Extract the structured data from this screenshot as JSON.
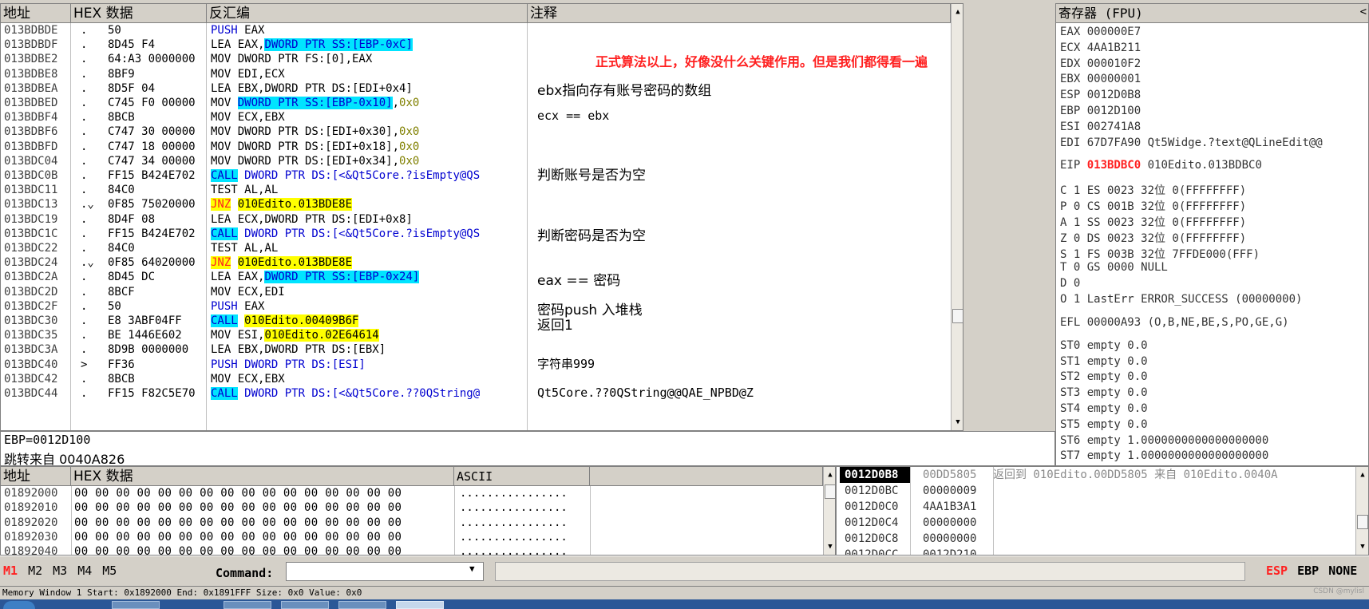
{
  "disasm": {
    "headers": {
      "addr": "地址",
      "hex": "HEX 数据",
      "asm": "反汇编",
      "comment": "注释"
    },
    "rows": [
      {
        "addr": "013BDBDE",
        "m": ".",
        "hex": "50",
        "asm": [
          {
            "t": "PUSH",
            "c": "kw-blue"
          },
          {
            "t": " EAX"
          }
        ]
      },
      {
        "addr": "013BDBDF",
        "m": ".",
        "hex": "8D45 F4",
        "asm": [
          {
            "t": "LEA EAX,"
          },
          {
            "t": "DWORD PTR SS:[EBP-0xC]",
            "c": "hl-c kw-blue"
          }
        ]
      },
      {
        "addr": "013BDBE2",
        "m": ".",
        "hex": "64:A3 0000000",
        "asm": [
          {
            "t": "MOV DWORD PTR FS:[0],EAX"
          }
        ]
      },
      {
        "addr": "013BDBE8",
        "m": ".",
        "hex": "8BF9",
        "asm": [
          {
            "t": "MOV EDI,ECX"
          }
        ]
      },
      {
        "addr": "013BDBEA",
        "m": ".",
        "hex": "8D5F 04",
        "asm": [
          {
            "t": "LEA EBX,DWORD PTR DS:[EDI+0x4]"
          }
        ]
      },
      {
        "addr": "013BDBED",
        "m": ".",
        "hex": "C745 F0 00000",
        "asm": [
          {
            "t": "MOV "
          },
          {
            "t": "DWORD PTR SS:[EBP-0x10]",
            "c": "hl-c kw-blue"
          },
          {
            "t": ","
          },
          {
            "t": "0x0",
            "c": "num-o"
          }
        ]
      },
      {
        "addr": "013BDBF4",
        "m": ".",
        "hex": "8BCB",
        "asm": [
          {
            "t": "MOV ECX,EBX"
          }
        ]
      },
      {
        "addr": "013BDBF6",
        "m": ".",
        "hex": "C747 30 00000",
        "asm": [
          {
            "t": "MOV DWORD PTR DS:[EDI+0x30],"
          },
          {
            "t": "0x0",
            "c": "num-o"
          }
        ]
      },
      {
        "addr": "013BDBFD",
        "m": ".",
        "hex": "C747 18 00000",
        "asm": [
          {
            "t": "MOV DWORD PTR DS:[EDI+0x18],"
          },
          {
            "t": "0x0",
            "c": "num-o"
          }
        ]
      },
      {
        "addr": "013BDC04",
        "m": ".",
        "hex": "C747 34 00000",
        "asm": [
          {
            "t": "MOV DWORD PTR DS:[EDI+0x34],"
          },
          {
            "t": "0x0",
            "c": "num-o"
          }
        ]
      },
      {
        "addr": "013BDC0B",
        "m": ".",
        "hex": "FF15 B424E702",
        "asm": [
          {
            "t": "CALL",
            "c": "hl-c kw-blue"
          },
          {
            "t": " DWORD PTR DS:[<&Qt5Core.?isEmpty@QS",
            "c": "kw-blue"
          }
        ]
      },
      {
        "addr": "013BDC11",
        "m": ".",
        "hex": "84C0",
        "asm": [
          {
            "t": "TEST AL,AL"
          }
        ]
      },
      {
        "addr": "013BDC13",
        "m": ".⌄",
        "hex": "0F85 75020000",
        "asm": [
          {
            "t": "JNZ",
            "c": "hl-y kw-red"
          },
          {
            "t": " "
          },
          {
            "t": "010Edito.013BDE8E",
            "c": "hl-y"
          }
        ]
      },
      {
        "addr": "013BDC19",
        "m": ".",
        "hex": "8D4F 08",
        "asm": [
          {
            "t": "LEA ECX,DWORD PTR DS:[EDI+0x8]"
          }
        ]
      },
      {
        "addr": "013BDC1C",
        "m": ".",
        "hex": "FF15 B424E702",
        "asm": [
          {
            "t": "CALL",
            "c": "hl-c kw-blue"
          },
          {
            "t": " DWORD PTR DS:[<&Qt5Core.?isEmpty@QS",
            "c": "kw-blue"
          }
        ]
      },
      {
        "addr": "013BDC22",
        "m": ".",
        "hex": "84C0",
        "asm": [
          {
            "t": "TEST AL,AL"
          }
        ]
      },
      {
        "addr": "013BDC24",
        "m": ".⌄",
        "hex": "0F85 64020000",
        "asm": [
          {
            "t": "JNZ",
            "c": "hl-y kw-red"
          },
          {
            "t": " "
          },
          {
            "t": "010Edito.013BDE8E",
            "c": "hl-y"
          }
        ]
      },
      {
        "addr": "013BDC2A",
        "m": ".",
        "hex": "8D45 DC",
        "asm": [
          {
            "t": "LEA EAX,"
          },
          {
            "t": "DWORD PTR SS:[EBP-0x24]",
            "c": "hl-c kw-blue"
          }
        ]
      },
      {
        "addr": "013BDC2D",
        "m": ".",
        "hex": "8BCF",
        "asm": [
          {
            "t": "MOV ECX,EDI"
          }
        ]
      },
      {
        "addr": "013BDC2F",
        "m": ".",
        "hex": "50",
        "asm": [
          {
            "t": "PUSH",
            "c": "kw-blue"
          },
          {
            "t": " EAX"
          }
        ]
      },
      {
        "addr": "013BDC30",
        "m": ".",
        "hex": "E8 3ABF04FF",
        "asm": [
          {
            "t": "CALL",
            "c": "hl-c kw-blue"
          },
          {
            "t": " "
          },
          {
            "t": "010Edito.00409B6F",
            "c": "hl-y"
          }
        ]
      },
      {
        "addr": "013BDC35",
        "m": ".",
        "hex": "BE 1446E602",
        "asm": [
          {
            "t": "MOV ESI,"
          },
          {
            "t": "010Edito.02E64614",
            "c": "hl-y"
          }
        ]
      },
      {
        "addr": "013BDC3A",
        "m": ".",
        "hex": "8D9B 0000000",
        "asm": [
          {
            "t": "LEA EBX,DWORD PTR DS:[EBX]"
          }
        ]
      },
      {
        "addr": "013BDC40",
        "m": ">",
        "hex": "FF36",
        "asm": [
          {
            "t": "PUSH",
            "c": "kw-blue"
          },
          {
            "t": " DWORD PTR DS:[ESI]",
            "c": "kw-blue"
          }
        ]
      },
      {
        "addr": "013BDC42",
        "m": ".",
        "hex": "8BCB",
        "asm": [
          {
            "t": "MOV ECX,EBX"
          }
        ]
      },
      {
        "addr": "013BDC44",
        "m": ".",
        "hex": "FF15 F82C5E70",
        "asm": [
          {
            "t": "CALL",
            "c": "hl-c kw-blue"
          },
          {
            "t": " DWORD PTR DS:[<&Qt5Core.??0QString@",
            "c": "kw-blue"
          }
        ]
      }
    ],
    "comments": [
      {
        "text": "正式算法以上，好像没什么关键作用。但是我们都得看一遍",
        "red": true
      },
      {
        "text": "ebx指向存有账号密码的数组"
      },
      {
        "text": "ecx == ebx"
      },
      {
        "text": "判断账号是否为空"
      },
      {
        "text": "判断密码是否为空"
      },
      {
        "text": "eax == 密码"
      },
      {
        "text": "密码push 入堆栈"
      },
      {
        "text": "返回1"
      },
      {
        "text": "字符串999"
      },
      {
        "text": "Qt5Core.??0QString@@QAE_NPBD@Z"
      }
    ]
  },
  "info": {
    "line1": "EBP=0012D100",
    "line2": "跳转来自  0040A826"
  },
  "registers": {
    "title": "寄存器 (FPU)",
    "gpr": [
      {
        "name": "EAX",
        "val": "000000E7"
      },
      {
        "name": "ECX",
        "val": "4AA1B211"
      },
      {
        "name": "EDX",
        "val": "000010F2"
      },
      {
        "name": "EBX",
        "val": "00000001"
      },
      {
        "name": "ESP",
        "val": "0012D0B8"
      },
      {
        "name": "EBP",
        "val": "0012D100"
      },
      {
        "name": "ESI",
        "val": "002741A8"
      },
      {
        "name": "EDI",
        "val": "67D7FA90 Qt5Widge.?text@QLineEdit@@"
      }
    ],
    "eip": {
      "name": "EIP",
      "val": "013BDBC0",
      "extra": "010Edito.013BDBC0"
    },
    "flags": [
      "C 1   ES 0023 32位 0(FFFFFFFF)",
      "P 0   CS 001B 32位 0(FFFFFFFF)",
      "A 1   SS 0023 32位 0(FFFFFFFF)",
      "Z 0   DS 0023 32位 0(FFFFFFFF)",
      "S 1   FS 003B 32位 7FFDE000(FFF)",
      "T 0   GS 0000 NULL",
      "D 0",
      "O 1   LastErr ERROR_SUCCESS (00000000)"
    ],
    "efl": "EFL 00000A93 (O,B,NE,BE,S,PO,GE,G)",
    "fpu": [
      "ST0 empty 0.0",
      "ST1 empty 0.0",
      "ST2 empty 0.0",
      "ST3 empty 0.0",
      "ST4 empty 0.0",
      "ST5 empty 0.0",
      "ST6 empty 1.0000000000000000000",
      "ST7 empty 1.0000000000000000000"
    ]
  },
  "dump": {
    "headers": {
      "addr": "地址",
      "hex": "HEX 数据",
      "ascii": "ASCII"
    },
    "rows": [
      {
        "addr": "01892000",
        "hex": "00 00 00 00 00 00 00 00 00 00 00 00 00 00 00 00",
        "ascii": "................"
      },
      {
        "addr": "01892010",
        "hex": "00 00 00 00 00 00 00 00 00 00 00 00 00 00 00 00",
        "ascii": "................"
      },
      {
        "addr": "01892020",
        "hex": "00 00 00 00 00 00 00 00 00 00 00 00 00 00 00 00",
        "ascii": "................"
      },
      {
        "addr": "01892030",
        "hex": "00 00 00 00 00 00 00 00 00 00 00 00 00 00 00 00",
        "ascii": "................"
      },
      {
        "addr": "01892040",
        "hex": "00 00 00 00 00 00 00 00 00 00 00 00 00 00 00 00",
        "ascii": "................"
      }
    ]
  },
  "stack": {
    "rows": [
      {
        "addr": "0012D0B8",
        "val": "00DD5805",
        "cmt": "返回到  010Edito.00DD5805 来自  010Edito.0040A"
      },
      {
        "addr": "0012D0BC",
        "val": "00000009",
        "cmt": ""
      },
      {
        "addr": "0012D0C0",
        "val": "4AA1B3A1",
        "cmt": ""
      },
      {
        "addr": "0012D0C4",
        "val": "00000000",
        "cmt": ""
      },
      {
        "addr": "0012D0C8",
        "val": "00000000",
        "cmt": ""
      },
      {
        "addr": "0012D0CC",
        "val": "0012D210",
        "cmt": ""
      }
    ]
  },
  "command": {
    "tabs": [
      "M1",
      "M2",
      "M3",
      "M4",
      "M5"
    ],
    "label": "Command:",
    "value": "",
    "right": [
      "ESP",
      "EBP",
      "NONE"
    ]
  },
  "status": {
    "text": "Memory Window 1  Start: 0x1892000  End: 0x1891FFF  Size: 0x0 Value: 0x0"
  },
  "watermark": "CSDN @mylisl",
  "colors": {
    "accent_red": "#ff2020",
    "highlight_yellow": "#ffff00",
    "highlight_cyan": "#00e4ff",
    "asm_blue": "#0000d0"
  }
}
